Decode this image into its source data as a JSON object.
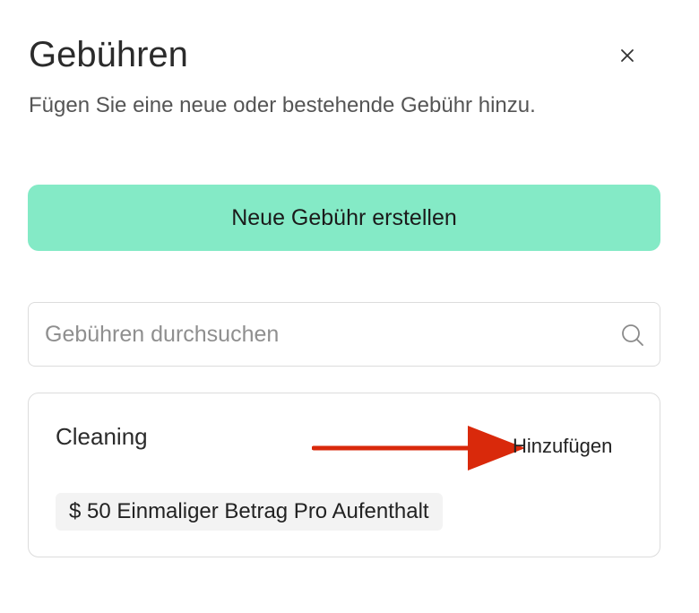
{
  "dialog": {
    "title": "Gebühren",
    "subtitle": "Fügen Sie eine neue oder bestehende Gebühr hinzu.",
    "close_icon": "close-icon"
  },
  "actions": {
    "create_label": "Neue Gebühr erstellen",
    "create_color": "#84eac6"
  },
  "search": {
    "placeholder": "Gebühren durchsuchen",
    "value": "",
    "icon": "search-icon"
  },
  "fees": [
    {
      "name": "Cleaning",
      "add_label": "Hinzufügen",
      "amount_label": "$ 50 Einmaliger Betrag Pro Aufenthalt"
    }
  ],
  "annotation": {
    "icon": "arrow-right-icon",
    "color": "#d9290b"
  }
}
